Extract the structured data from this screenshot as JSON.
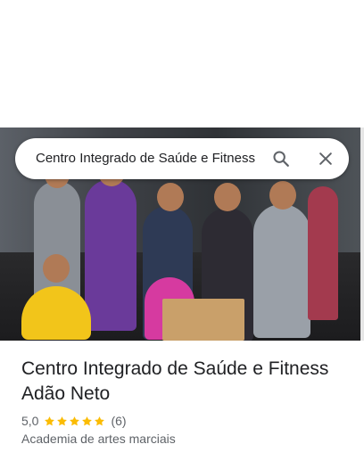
{
  "search": {
    "query": "Centro Integrado de Saúde e Fitness"
  },
  "place": {
    "name": "Centro Integrado de Saúde e Fitness Adão Neto",
    "rating": "5,0",
    "rating_value": 5.0,
    "stars_max": 5,
    "review_count": "(6)",
    "category": "Academia de artes marciais"
  },
  "colors": {
    "star": "#fbbc04",
    "primary_text": "#202124",
    "secondary_text": "#5f6368"
  },
  "icons": {
    "search": "search-icon",
    "close": "close-icon"
  }
}
